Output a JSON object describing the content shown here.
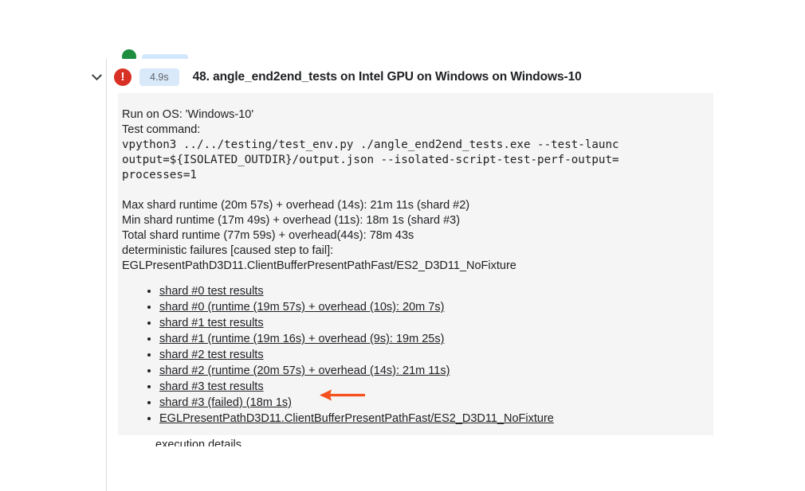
{
  "clipped_above": {
    "check_icon": "green-check-icon",
    "badge_placeholder": "duration-badge-placeholder"
  },
  "step": {
    "expand_icon": "chevron-down-icon",
    "status_icon": "error-icon",
    "status_glyph": "!",
    "duration": "4.9s",
    "title": "48. angle_end2end_tests on Intel GPU on Windows on Windows-10"
  },
  "panel": {
    "lines": [
      {
        "type": "text",
        "text": "Run on OS: 'Windows-10'"
      },
      {
        "type": "text",
        "text": "Test command:"
      },
      {
        "type": "mono",
        "text": "vpython3 ../../testing/test_env.py ./angle_end2end_tests.exe --test-launc"
      },
      {
        "type": "mono",
        "text": "output=${ISOLATED_OUTDIR}/output.json --isolated-script-test-perf-output="
      },
      {
        "type": "mono",
        "text": "processes=1"
      },
      {
        "type": "blank",
        "text": ""
      },
      {
        "type": "text",
        "text": "Max shard runtime (20m 57s) + overhead (14s): 21m 11s (shard #2)"
      },
      {
        "type": "text",
        "text": "Min shard runtime (17m 49s) + overhead (11s): 18m 1s (shard #3)"
      },
      {
        "type": "text",
        "text": "Total shard runtime (77m 59s) + overhead(44s): 78m 43s"
      },
      {
        "type": "text",
        "text": "deterministic failures [caused step to fail]:"
      },
      {
        "type": "text",
        "text": "EGLPresentPathD3D11.ClientBufferPresentPathFast/ES2_D3D11_NoFixture"
      }
    ],
    "links": [
      "shard #0 test results",
      "shard #0 (runtime (19m 57s) + overhead (10s): 20m 7s)",
      "shard #1 test results",
      "shard #1 (runtime (19m 16s) + overhead (9s): 19m 25s)",
      "shard #2 test results",
      "shard #2 (runtime (20m 57s) + overhead (14s): 21m 11s)",
      "shard #3 test results",
      "shard #3 (failed) (18m 1s)",
      "EGLPresentPathD3D11.ClientBufferPresentPathFast/ES2_D3D11_NoFixture"
    ],
    "clipped_bottom_text": "execution details"
  },
  "annotation": {
    "arrow_name": "red-left-arrow",
    "arrow_color": "#f4511e",
    "points_to": "shard #3 (failed) (18m 1s)"
  },
  "colors": {
    "error_red": "#d93025",
    "badge_blue": "#d9e9fa",
    "panel_gray": "#f5f5f5",
    "text_dark": "#202124",
    "guide_gray": "#dadce0",
    "green_check": "#1e8e3e",
    "arrow_red": "#f4511e"
  }
}
